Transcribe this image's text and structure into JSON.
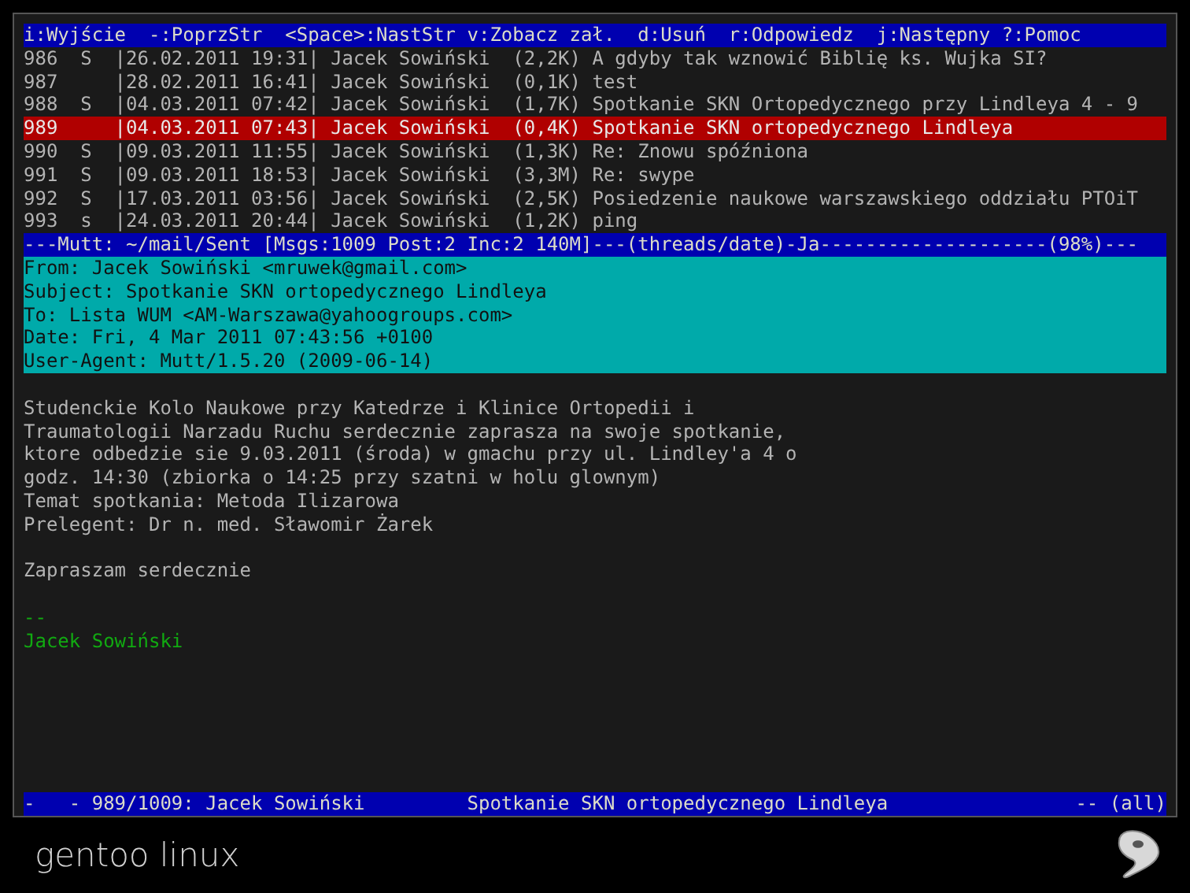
{
  "help_bar": "i:Wyjście  -:PoprzStr  <Space>:NastStr v:Zobacz zał.  d:Usuń  r:Odpowiedz  j:Następny ?:Pomoc",
  "index": [
    {
      "text": "986  S  |26.02.2011 19:31| Jacek Sowiński  (2,2K) A gdyby tak wznowić Biblię ks. Wujka SI?",
      "selected": false
    },
    {
      "text": "987     |28.02.2011 16:41| Jacek Sowiński  (0,1K) test",
      "selected": false
    },
    {
      "text": "988  S  |04.03.2011 07:42| Jacek Sowiński  (1,7K) Spotkanie SKN Ortopedycznego przy Lindleya 4 - 9",
      "selected": false
    },
    {
      "text": "989     |04.03.2011 07:43| Jacek Sowiński  (0,4K) Spotkanie SKN ortopedycznego Lindleya",
      "selected": true
    },
    {
      "text": "990  S  |09.03.2011 11:55| Jacek Sowiński  (1,3K) Re: Znowu spóźniona",
      "selected": false
    },
    {
      "text": "991  S  |09.03.2011 18:53| Jacek Sowiński  (3,3M) Re: swype",
      "selected": false
    },
    {
      "text": "992  S  |17.03.2011 03:56| Jacek Sowiński  (2,5K) Posiedzenie naukowe warszawskiego oddziału PTOiT",
      "selected": false
    },
    {
      "text": "993  s  |24.03.2011 20:44| Jacek Sowiński  (1,2K) ping",
      "selected": false
    }
  ],
  "status_bar": "---Mutt: ~/mail/Sent [Msgs:1009 Post:2 Inc:2 140M]---(threads/date)-Ja--------------------(98%)---",
  "headers": [
    "From: Jacek Sowiński <mruwek@gmail.com>",
    "Subject: Spotkanie SKN ortopedycznego Lindleya",
    "To: Lista WUM <AM-Warszawa@yahoogroups.com>",
    "Date: Fri, 4 Mar 2011 07:43:56 +0100",
    "User-Agent: Mutt/1.5.20 (2009-06-14)"
  ],
  "body": [
    {
      "kind": "blank"
    },
    {
      "kind": "text",
      "text": "Studenckie Kolo Naukowe przy Katedrze i Klinice Ortopedii i"
    },
    {
      "kind": "text",
      "text": "Traumatologii Narzadu Ruchu serdecznie zaprasza na swoje spotkanie,"
    },
    {
      "kind": "text",
      "text": "ktore odbedzie sie 9.03.2011 (środa) w gmachu przy ul. Lindley'a 4 o"
    },
    {
      "kind": "text",
      "text": "godz. 14:30 (zbiorka o 14:25 przy szatni w holu glownym)"
    },
    {
      "kind": "text",
      "text": "Temat spotkania: Metoda Ilizarowa"
    },
    {
      "kind": "text",
      "text": "Prelegent: Dr n. med. Sławomir Żarek"
    },
    {
      "kind": "blank"
    },
    {
      "kind": "text",
      "text": "Zapraszam serdecznie"
    },
    {
      "kind": "blank"
    },
    {
      "kind": "signature",
      "text": "--"
    },
    {
      "kind": "signature",
      "text": "Jacek Sowiński"
    }
  ],
  "pager_bar": {
    "left": "-   - 989/1009: Jacek Sowiński         Spotkanie SKN ortopedycznego Lindleya",
    "right": "-- (all)"
  },
  "brand": "gentoo linux"
}
